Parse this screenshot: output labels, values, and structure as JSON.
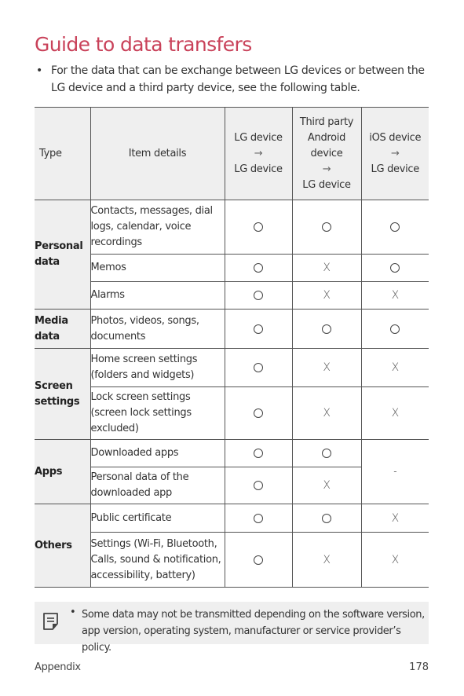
{
  "page": {
    "title": "Guide to data transfers",
    "intro_bullet": "•",
    "intro": "For the data that can be exchange between LG devices or between the LG device and a third party device, see the following table."
  },
  "table": {
    "headers": {
      "type": "Type",
      "item": "Item details",
      "lg": [
        "LG device",
        "→",
        "LG device"
      ],
      "third": [
        "Third party",
        "Android",
        "device",
        "→",
        "LG device"
      ],
      "ios": [
        "iOS device",
        "→",
        "LG device"
      ]
    },
    "groups": [
      {
        "type": "Personal data",
        "rows": [
          {
            "item": "Contacts, messages, dial logs, calendar, voice recordings",
            "lg": "O",
            "third": "O",
            "ios": "O"
          },
          {
            "item": "Memos",
            "lg": "O",
            "third": "X",
            "ios": "O"
          },
          {
            "item": "Alarms",
            "lg": "O",
            "third": "X",
            "ios": "X"
          }
        ]
      },
      {
        "type": "Media data",
        "rows": [
          {
            "item": "Photos, videos, songs, documents",
            "lg": "O",
            "third": "O",
            "ios": "O"
          }
        ]
      },
      {
        "type": "Screen settings",
        "rows": [
          {
            "item": "Home screen settings (folders and widgets)",
            "lg": "O",
            "third": "X",
            "ios": "X"
          },
          {
            "item": "Lock screen settings (screen lock settings excluded)",
            "lg": "O",
            "third": "X",
            "ios": "X"
          }
        ]
      },
      {
        "type": "Apps",
        "rows": [
          {
            "item": "Downloaded apps",
            "lg": "O",
            "third": "O",
            "ios": "-"
          },
          {
            "item": "Personal data of the downloaded app",
            "lg": "O",
            "third": "X",
            "ios": "-"
          }
        ]
      },
      {
        "type": "Others",
        "rows": [
          {
            "item": "Public certificate",
            "lg": "O",
            "third": "O",
            "ios": "X"
          },
          {
            "item": "Settings (Wi-Fi, Bluetooth, Calls, sound & notification, accessibility, battery)",
            "lg": "O",
            "third": "X",
            "ios": "X"
          }
        ]
      }
    ],
    "marks": {
      "cross": "X",
      "dash": "-"
    }
  },
  "note": {
    "icon": "note-icon",
    "bullet": "•",
    "text": "Some data may not be transmitted depending on the software version, app version, operating system, manufacturer or service provider’s policy."
  },
  "footer": {
    "section": "Appendix",
    "page_number": "178"
  },
  "colors": {
    "title": "#c9425a",
    "header_bg": "#efefef",
    "border": "#555555"
  }
}
